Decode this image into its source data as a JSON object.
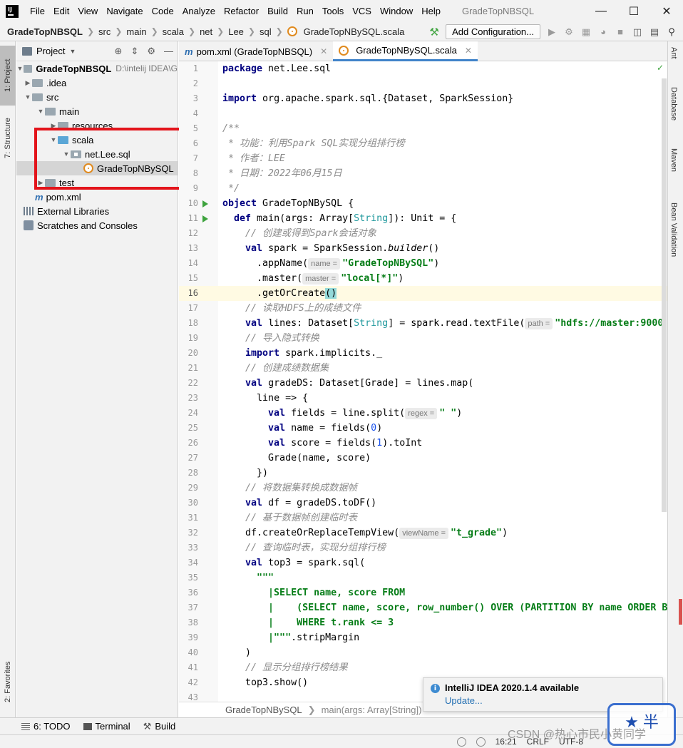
{
  "menubar": {
    "items": [
      "File",
      "Edit",
      "View",
      "Navigate",
      "Code",
      "Analyze",
      "Refactor",
      "Build",
      "Run",
      "Tools",
      "VCS",
      "Window",
      "Help"
    ],
    "window_title": "GradeTopNBSQL"
  },
  "navbar": {
    "crumbs": [
      "GradeTopNBSQL",
      "src",
      "main",
      "scala",
      "net",
      "Lee",
      "sql",
      "GradeTopNBySQL.scala"
    ],
    "add_config": "Add Configuration..."
  },
  "left_stripe": {
    "project": "1: Project",
    "structure": "7: Structure",
    "favorites": "2: Favorites"
  },
  "right_stripe": {
    "ant": "Ant",
    "database": "Database",
    "maven": "Maven",
    "bean": "Bean Validation"
  },
  "project_panel": {
    "title": "Project",
    "tree": [
      {
        "label": "GradeTopNBSQL",
        "path": "D:\\intelij IDEA\\G"
      },
      {
        "label": ".idea"
      },
      {
        "label": "src"
      },
      {
        "label": "main"
      },
      {
        "label": "resources"
      },
      {
        "label": "scala"
      },
      {
        "label": "net.Lee.sql"
      },
      {
        "label": "GradeTopNBySQL"
      },
      {
        "label": "test"
      },
      {
        "label": "pom.xml"
      },
      {
        "label": "External Libraries"
      },
      {
        "label": "Scratches and Consoles"
      }
    ]
  },
  "tabs": [
    {
      "label": "pom.xml (GradeTopNBSQL)"
    },
    {
      "label": "GradeTopNBySQL.scala"
    }
  ],
  "editor": {
    "line_numbers": [
      "1",
      "2",
      "3",
      "4",
      "5",
      "6",
      "7",
      "8",
      "9",
      "10",
      "11",
      "12",
      "13",
      "14",
      "15",
      "16",
      "17",
      "18",
      "19",
      "20",
      "21",
      "22",
      "23",
      "24",
      "25",
      "26",
      "27",
      "28",
      "29",
      "30",
      "31",
      "32",
      "33",
      "34",
      "35",
      "36",
      "37",
      "38",
      "39",
      "40",
      "41",
      "42",
      "43"
    ],
    "hints": {
      "name": "name =",
      "master": "master =",
      "path": "path =",
      "regex": "regex =",
      "viewName": "viewName ="
    },
    "text": {
      "l1_kw": "package",
      "l1_rest": " net.Lee.sql",
      "l3_kw": "import",
      "l3_rest": " org.apache.spark.sql.{Dataset, SparkSession}",
      "l5": "/**",
      "l6": " * 功能：利用Spark SQL实现分组排行榜",
      "l7": " * 作者：LEE",
      "l8": " * 日期：2022年06月15日",
      "l9": " */",
      "l10_kw": "object",
      "l10_rest": " GradeTopNBySQL {",
      "l11_kw": "def",
      "l11_a": " main(args: Array[",
      "l11_ty": "String",
      "l11_b": "]): Unit = {",
      "l12": "// 创建或得到Spark会话对象",
      "l13_kw": "val",
      "l13_a": " spark = SparkSession.",
      "l13_it": "builder",
      "l13_b": "()",
      "l14_a": ".appName(",
      "l14_str": "\"GradeTopNBySQL\"",
      "l14_b": ")",
      "l15_a": ".master(",
      "l15_str": "\"local[*]\"",
      "l15_b": ")",
      "l16_a": ".getOrCreate",
      "l16_b": "()",
      "l17": "// 读取HDFS上的成绩文件",
      "l18_kw": "val",
      "l18_a": " lines: Dataset[",
      "l18_ty": "String",
      "l18_b": "] = spark.read.textFile(",
      "l18_str": "\"hdfs://master:9000",
      "l19": "// 导入隐式转换",
      "l20_kw": "import",
      "l20_rest": " spark.implicits._",
      "l21": "// 创建成绩数据集",
      "l22_kw": "val",
      "l22_rest": " gradeDS: Dataset[Grade] = lines.map(",
      "l23": "line => {",
      "l24_kw": "val",
      "l24_a": " fields = line.split(",
      "l24_str": "\" \"",
      "l24_b": ")",
      "l25_kw": "val",
      "l25_a": " name = fields(",
      "l25_num": "0",
      "l25_b": ")",
      "l26_kw": "val",
      "l26_a": " score = fields(",
      "l26_num": "1",
      "l26_b": ").toInt",
      "l27": "Grade(name, score)",
      "l28": "})",
      "l29": "// 将数据集转换成数据帧",
      "l30_kw": "val",
      "l30_rest": " df = gradeDS.toDF()",
      "l31": "// 基于数据帧创建临时表",
      "l32_a": "df.createOrReplaceTempView(",
      "l32_str": "\"t_grade\"",
      "l32_b": ")",
      "l33": "// 查询临时表，实现分组排行榜",
      "l34_kw": "val",
      "l34_rest": " top3 = spark.sql(",
      "l35": "\"\"\"",
      "l36": "|SELECT name, score FROM",
      "l37": "|    (SELECT name, score, row_number() OVER (PARTITION BY name ORDER B",
      "l38": "|    WHERE t.rank <= 3",
      "l39_str": "|\"\"\"",
      "l39_rest": ".stripMargin",
      "l40": ")",
      "l41": "// 显示分组排行榜结果",
      "l42": "top3.show()"
    }
  },
  "editor_breadcrumb": {
    "file": "GradeTopNBySQL",
    "method": "main(args: Array[String])"
  },
  "notification": {
    "title": "IntelliJ IDEA 2020.1.4 available",
    "link": "Update..."
  },
  "bottom_tools": {
    "todo": "6: TODO",
    "terminal": "Terminal",
    "build": "Build"
  },
  "statusbar": {
    "position": "16:21",
    "line_sep": "CRLF",
    "encoding": "UTF-8"
  },
  "watermark": {
    "text": "CSDN @热心市民小黄同学"
  }
}
